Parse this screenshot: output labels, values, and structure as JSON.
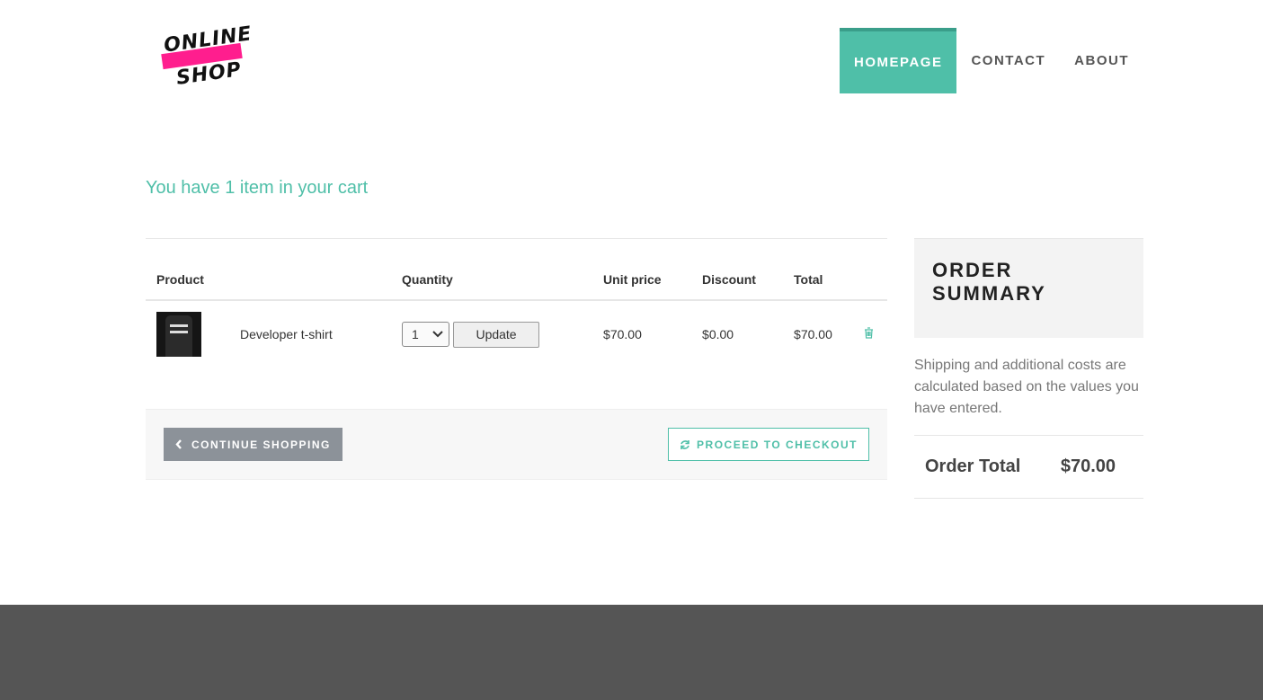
{
  "logo": {
    "line1": "ONLINE",
    "line2": "SHOP",
    "accent": "#ff1e8e"
  },
  "nav": {
    "items": [
      {
        "label": "HOMEPAGE",
        "active": true
      },
      {
        "label": "CONTACT",
        "active": false
      },
      {
        "label": "ABOUT",
        "active": false
      }
    ]
  },
  "cart": {
    "heading": "You have 1 item in your cart",
    "columns": [
      "Product",
      "Quantity",
      "Unit price",
      "Discount",
      "Total"
    ],
    "rows": [
      {
        "image_icon": "tshirt-thumbnail",
        "name": "Developer t-shirt",
        "quantity": "1",
        "update_label": "Update",
        "unit_price": "$70.00",
        "discount": "$0.00",
        "total": "$70.00",
        "remove_icon": "trash-icon"
      }
    ],
    "continue_label": "CONTINUE SHOPPING",
    "checkout_label": "PROCEED TO CHECKOUT"
  },
  "summary": {
    "title": "ORDER SUMMARY",
    "note": "Shipping and additional costs are calculated based on the values you have entered.",
    "total_label": "Order Total",
    "total_value": "$70.00"
  },
  "colors": {
    "accent": "#4fbfa8",
    "footer": "#555555",
    "button_grey": "#8c9299"
  }
}
